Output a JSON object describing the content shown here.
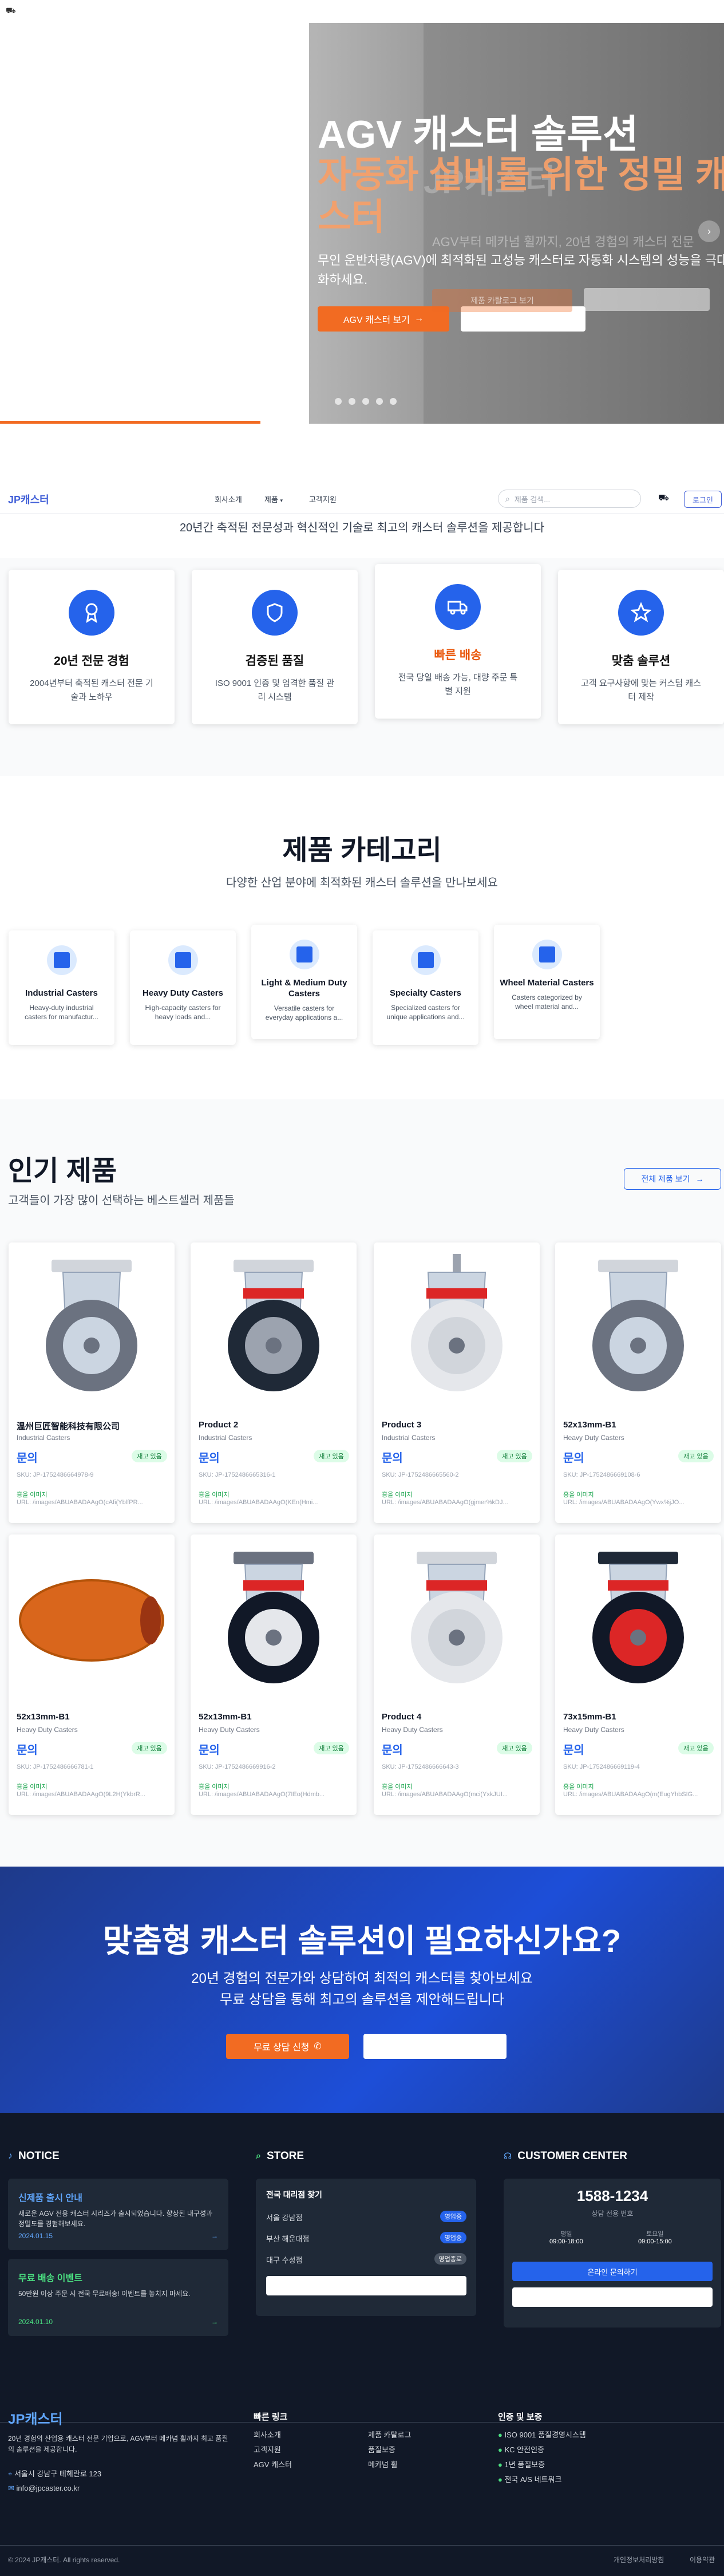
{
  "topbar": {
    "cart_icon": "cart-icon"
  },
  "hero": {
    "title": "AGV 캐스터 솔루션",
    "subtitle": "자동화 설비를 위한 정밀 캐스터",
    "ghost_title": "JP캐스터",
    "description": "무인 운반차량(AGV)에 최적화된 고성능 캐스터로 자동화 시스템의 성능을 극대화하세요.",
    "ghost_desc": "AGV부터 메카넘 휠까지, 20년 경험의 캐스터 전문",
    "primary_button": "AGV 캐스터 보기",
    "secondary_button": "제품 카탈로그 보기",
    "slides": 5,
    "progress": 0.36
  },
  "nav": {
    "logo": "JP캐스터",
    "items": [
      "회사소개",
      "제품",
      "고객지원"
    ],
    "search_placeholder": "제품 검색...",
    "login": "로그인"
  },
  "intro": {
    "text": "20년간 축적된 전문성과 혁신적인 기술로 최고의 캐스터 솔루션을 제공합니다"
  },
  "features": [
    {
      "title": "20년 전문 경험",
      "desc": "2004년부터 축적된 캐스터 전문 기술과 노하우",
      "icon": "award-icon"
    },
    {
      "title": "검증된 품질",
      "desc": "ISO 9001 인증 및 엄격한 품질 관리 시스템",
      "icon": "shield-icon"
    },
    {
      "title": "빠른 배송",
      "desc": "전국 당일 배송 가능, 대량 주문 특별 지원",
      "icon": "truck-icon"
    },
    {
      "title": "맞춤 솔루션",
      "desc": "고객 요구사항에 맞는 커스텀 캐스터 제작",
      "icon": "star-icon"
    }
  ],
  "categories": {
    "title": "제품 카테고리",
    "subtitle": "다양한 산업 분야에 최적화된 캐스터 솔루션을 만나보세요",
    "items": [
      {
        "name": "Industrial Casters",
        "desc": "Heavy-duty industrial casters for manufactur..."
      },
      {
        "name": "Heavy Duty Casters",
        "desc": "High-capacity casters for heavy loads and..."
      },
      {
        "name": "Light & Medium Duty Casters",
        "desc": "Versatile casters for everyday applications a..."
      },
      {
        "name": "Specialty Casters",
        "desc": "Specialized casters for unique applications and..."
      },
      {
        "name": "Wheel Material Casters",
        "desc": "Casters categorized by wheel material and..."
      }
    ]
  },
  "popular": {
    "title": "인기 제품",
    "subtitle": "고객들이 가장 많이 선택하는 베스트셀러 제품들",
    "all_button": "전체 제품 보기",
    "products": [
      {
        "name": "温州巨匠智能科技有限公司",
        "category": "Industrial Casters",
        "price": "문의",
        "stock": "재고 있음",
        "sku": "SKU: JP-1752486664978-9",
        "ship": "흥을 이미지",
        "url": "URL: /images/ABUABADAAgO(cAfi(YblfPR..."
      },
      {
        "name": "Product 2",
        "category": "Industrial Casters",
        "price": "문의",
        "stock": "재고 있음",
        "sku": "SKU: JP-1752486665316-1",
        "ship": "흥을 이미지",
        "url": "URL: /images/ABUABADAAgO(KEn(Hmi..."
      },
      {
        "name": "Product 3",
        "category": "Industrial Casters",
        "price": "문의",
        "stock": "재고 있음",
        "sku": "SKU: JP-1752486665560-2",
        "ship": "흥을 이미지",
        "url": "URL: /images/ABUABADAAgO(gjmer%kDJ..."
      },
      {
        "name": "52x13mm-B1",
        "category": "Heavy Duty Casters",
        "price": "문의",
        "stock": "재고 있음",
        "sku": "SKU: JP-1752486669108-6",
        "ship": "흥을 이미지",
        "url": "URL: /images/ABUABADAAgO(Ywx%jJO..."
      },
      {
        "name": "52x13mm-B1",
        "category": "Heavy Duty Casters",
        "price": "문의",
        "stock": "재고 있음",
        "sku": "SKU: JP-1752486666781-1",
        "ship": "흥을 이미지",
        "url": "URL: /images/ABUABADAAgO(9L2H(YkbrR..."
      },
      {
        "name": "52x13mm-B1",
        "category": "Heavy Duty Casters",
        "price": "문의",
        "stock": "재고 있음",
        "sku": "SKU: JP-1752486669916-2",
        "ship": "흥을 이미지",
        "url": "URL: /images/ABUABADAAgO(7IEo(Hdmb..."
      },
      {
        "name": "Product 4",
        "category": "Heavy Duty Casters",
        "price": "문의",
        "stock": "재고 있음",
        "sku": "SKU: JP-1752486666643-3",
        "ship": "흥을 이미지",
        "url": "URL: /images/ABUABADAAgO(mci(YxkJUI..."
      },
      {
        "name": "73x15mm-B1",
        "category": "Heavy Duty Casters",
        "price": "문의",
        "stock": "재고 있음",
        "sku": "SKU: JP-1752486669119-4",
        "ship": "흥을 이미지",
        "url": "URL: /images/ABUABADAAgO(m(EugYhbSIG..."
      }
    ]
  },
  "cta": {
    "title": "맞춤형 캐스터 솔루션이 필요하신가요?",
    "line1": "20년 경험의 전문가와 상담하여 최적의 캐스터를 찾아보세요",
    "line2": "무료 상담을 통해 최고의 솔루션을 제안해드립니다",
    "primary": "무료 상담 신청",
    "phone_icon": "phone-icon"
  },
  "footer": {
    "notice_title": "NOTICE",
    "notices": [
      {
        "title": "신제품 출시 안내",
        "desc": "새로운 AGV 전용 캐스터 시리즈가 출시되었습니다. 향상된 내구성과 정밀도를 경험해보세요.",
        "date": "2024.01.15"
      },
      {
        "title": "무료 배송 이벤트",
        "desc": "50만원 이상 주문 시 전국 무료배송! 이벤트를 놓치지 마세요.",
        "date": "2024.01.10"
      }
    ],
    "store_title": "STORE",
    "store_heading": "전국 대리점 찾기",
    "stores": [
      {
        "name": "서울 강남점",
        "status": "영업중"
      },
      {
        "name": "부산 해운대점",
        "status": "영업중"
      },
      {
        "name": "대구 수성점",
        "status": "영업종료"
      }
    ],
    "center_title": "CUSTOMER CENTER",
    "phone": "1588-1234",
    "phone_label": "상담 전용 번호",
    "hours": [
      {
        "day": "평일",
        "time": "09:00-18:00"
      },
      {
        "day": "토요일",
        "time": "09:00-15:00"
      }
    ],
    "online_btn": "온라인 문의하기",
    "brand": "JP캐스터",
    "brand_desc": "20년 경험의 산업용 캐스터 전문 기업으로, AGV부터 메카넘 휠까지 최고 품질의 솔루션을 제공합니다.",
    "address": "서울시 강남구 테헤란로 123",
    "email": "info@jpcaster.co.kr",
    "quick_title": "빠른 링크",
    "quick_links": [
      "회사소개",
      "제품 카탈로그",
      "고객지원",
      "품질보증",
      "AGV 캐스터",
      "메카넘 휠"
    ],
    "cert_title": "인증 및 보증",
    "certs": [
      "ISO 9001 품질경영시스템",
      "KC 안전인증",
      "1년 품질보증",
      "전국 A/S 네트워크"
    ],
    "copyright": "© 2024 JP캐스터. All rights reserved.",
    "privacy": "개인정보처리방침",
    "terms": "이용약관"
  },
  "colors": {
    "accent": "#2563eb",
    "orange": "#f26b22",
    "footer_bg": "#111827"
  }
}
